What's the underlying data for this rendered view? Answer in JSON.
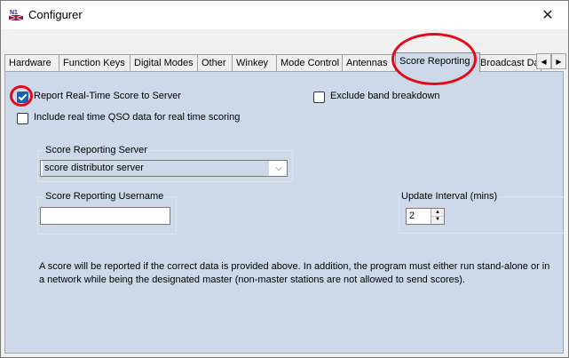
{
  "window": {
    "title": "Configurer",
    "icon": "n1mm-logo-icon",
    "close_glyph": "✕"
  },
  "tabs": [
    {
      "label": "Hardware",
      "active": false
    },
    {
      "label": "Function Keys",
      "active": false
    },
    {
      "label": "Digital Modes",
      "active": false
    },
    {
      "label": "Other",
      "active": false
    },
    {
      "label": "Winkey",
      "active": false
    },
    {
      "label": "Mode Control",
      "active": false
    },
    {
      "label": "Antennas",
      "active": false
    },
    {
      "label": "Score Reporting",
      "active": true
    },
    {
      "label": "Broadcast Data",
      "active": false
    }
  ],
  "tab_scroll": {
    "left_glyph": "◀",
    "right_glyph": "▶"
  },
  "annotation": {
    "color": "#e30b17"
  },
  "options": {
    "report_realtime": {
      "label": "Report Real-Time Score to Server",
      "checked": true
    },
    "exclude_band": {
      "label": "Exclude band breakdown",
      "checked": false
    },
    "include_qso": {
      "label": "Include real time QSO data for real time scoring",
      "checked": false
    }
  },
  "server": {
    "group_title": "Score Reporting Server",
    "selected": "score distributor server",
    "arrow_glyph": "⌵"
  },
  "username": {
    "group_title": "Score Reporting Username",
    "value": ""
  },
  "interval": {
    "label": "Update Interval (mins)",
    "value": "2",
    "up_glyph": "▲",
    "down_glyph": "▼"
  },
  "info_text": "A score will be reported if the correct data is provided above. In addition, the program must either run stand-alone or in a network while being the designated master (non-master stations are not allowed to send scores).",
  "colors": {
    "panel_bg": "#cdd9e9",
    "checkbox_checked": "#1a5fb4"
  }
}
